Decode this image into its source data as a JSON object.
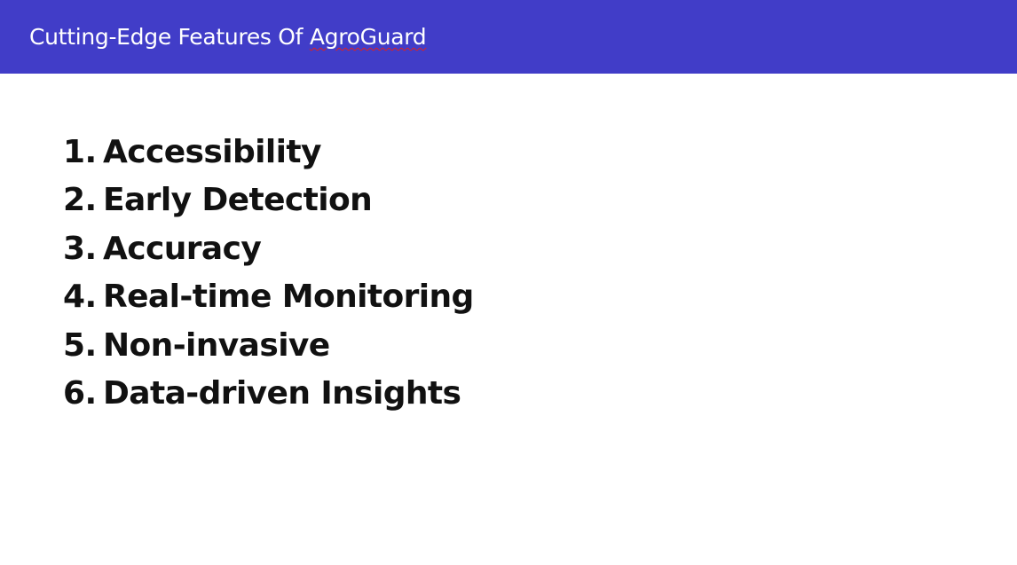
{
  "slide": {
    "title_prefix": "Cutting-Edge Features Of ",
    "title_brand": "AgroGuard",
    "colors": {
      "title_bar": "#413dc8",
      "title_text": "#ffffff",
      "body_text": "#111111",
      "spellcheck_underline": "#e02020"
    },
    "features": [
      {
        "number": "1.",
        "label": "Accessibility"
      },
      {
        "number": "2.",
        "label": "Early Detection"
      },
      {
        "number": "3.",
        "label": "Accuracy"
      },
      {
        "number": "4.",
        "label": "Real-time Monitoring"
      },
      {
        "number": "5.",
        "label": "Non-invasive"
      },
      {
        "number": "6.",
        "label": "Data-driven Insights"
      }
    ]
  }
}
